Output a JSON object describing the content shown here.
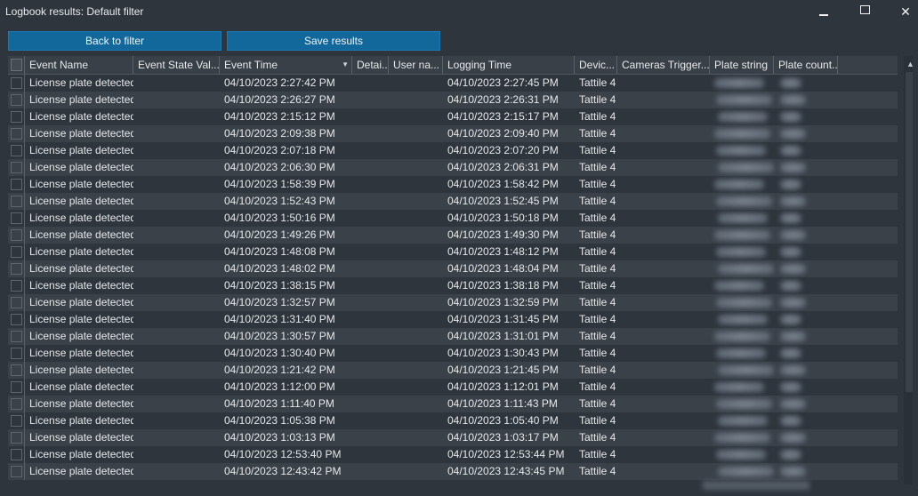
{
  "window": {
    "title": "Logbook results: Default filter",
    "minimize_icon": "minimize-icon",
    "maximize_icon": "maximize-icon",
    "close_icon": "close-icon",
    "close_glyph": "✕"
  },
  "toolbar": {
    "back_label": "Back to filter",
    "save_label": "Save results",
    "button_color": "#13689b"
  },
  "columns": [
    {
      "label": "Event Name"
    },
    {
      "label": "Event State Val..."
    },
    {
      "label": "Event Time",
      "sort_icon": "sort-down-icon",
      "sort_glyph": "▼"
    },
    {
      "label": "Detai..."
    },
    {
      "label": "User na..."
    },
    {
      "label": "Logging Time"
    },
    {
      "label": "Devic..."
    },
    {
      "label": "Cameras Trigger..."
    },
    {
      "label": "Plate string"
    },
    {
      "label": "Plate count..."
    }
  ],
  "rows": [
    {
      "event_name": "License plate detected",
      "event_time": "04/10/2023 2:27:42 PM",
      "logging_time": "04/10/2023 2:27:45 PM",
      "device": "Tattile 4"
    },
    {
      "event_name": "License plate detected",
      "event_time": "04/10/2023 2:26:27 PM",
      "logging_time": "04/10/2023 2:26:31 PM",
      "device": "Tattile 4"
    },
    {
      "event_name": "License plate detected",
      "event_time": "04/10/2023 2:15:12 PM",
      "logging_time": "04/10/2023 2:15:17 PM",
      "device": "Tattile 4"
    },
    {
      "event_name": "License plate detected",
      "event_time": "04/10/2023 2:09:38 PM",
      "logging_time": "04/10/2023 2:09:40 PM",
      "device": "Tattile 4"
    },
    {
      "event_name": "License plate detected",
      "event_time": "04/10/2023 2:07:18 PM",
      "logging_time": "04/10/2023 2:07:20 PM",
      "device": "Tattile 4"
    },
    {
      "event_name": "License plate detected",
      "event_time": "04/10/2023 2:06:30 PM",
      "logging_time": "04/10/2023 2:06:31 PM",
      "device": "Tattile 4"
    },
    {
      "event_name": "License plate detected",
      "event_time": "04/10/2023 1:58:39 PM",
      "logging_time": "04/10/2023 1:58:42 PM",
      "device": "Tattile 4"
    },
    {
      "event_name": "License plate detected",
      "event_time": "04/10/2023 1:52:43 PM",
      "logging_time": "04/10/2023 1:52:45 PM",
      "device": "Tattile 4"
    },
    {
      "event_name": "License plate detected",
      "event_time": "04/10/2023 1:50:16 PM",
      "logging_time": "04/10/2023 1:50:18 PM",
      "device": "Tattile 4"
    },
    {
      "event_name": "License plate detected",
      "event_time": "04/10/2023 1:49:26 PM",
      "logging_time": "04/10/2023 1:49:30 PM",
      "device": "Tattile 4"
    },
    {
      "event_name": "License plate detected",
      "event_time": "04/10/2023 1:48:08 PM",
      "logging_time": "04/10/2023 1:48:12 PM",
      "device": "Tattile 4"
    },
    {
      "event_name": "License plate detected",
      "event_time": "04/10/2023 1:48:02 PM",
      "logging_time": "04/10/2023 1:48:04 PM",
      "device": "Tattile 4"
    },
    {
      "event_name": "License plate detected",
      "event_time": "04/10/2023 1:38:15 PM",
      "logging_time": "04/10/2023 1:38:18 PM",
      "device": "Tattile 4"
    },
    {
      "event_name": "License plate detected",
      "event_time": "04/10/2023 1:32:57 PM",
      "logging_time": "04/10/2023 1:32:59 PM",
      "device": "Tattile 4"
    },
    {
      "event_name": "License plate detected",
      "event_time": "04/10/2023 1:31:40 PM",
      "logging_time": "04/10/2023 1:31:45 PM",
      "device": "Tattile 4"
    },
    {
      "event_name": "License plate detected",
      "event_time": "04/10/2023 1:30:57 PM",
      "logging_time": "04/10/2023 1:31:01 PM",
      "device": "Tattile 4"
    },
    {
      "event_name": "License plate detected",
      "event_time": "04/10/2023 1:30:40 PM",
      "logging_time": "04/10/2023 1:30:43 PM",
      "device": "Tattile 4"
    },
    {
      "event_name": "License plate detected",
      "event_time": "04/10/2023 1:21:42 PM",
      "logging_time": "04/10/2023 1:21:45 PM",
      "device": "Tattile 4"
    },
    {
      "event_name": "License plate detected",
      "event_time": "04/10/2023 1:12:00 PM",
      "logging_time": "04/10/2023 1:12:01 PM",
      "device": "Tattile 4"
    },
    {
      "event_name": "License plate detected",
      "event_time": "04/10/2023 1:11:40 PM",
      "logging_time": "04/10/2023 1:11:43 PM",
      "device": "Tattile 4"
    },
    {
      "event_name": "License plate detected",
      "event_time": "04/10/2023 1:05:38 PM",
      "logging_time": "04/10/2023 1:05:40 PM",
      "device": "Tattile 4"
    },
    {
      "event_name": "License plate detected",
      "event_time": "04/10/2023 1:03:13 PM",
      "logging_time": "04/10/2023 1:03:17 PM",
      "device": "Tattile 4"
    },
    {
      "event_name": "License plate detected",
      "event_time": "04/10/2023 12:53:40 PM",
      "logging_time": "04/10/2023 12:53:44 PM",
      "device": "Tattile 4"
    },
    {
      "event_name": "License plate detected",
      "event_time": "04/10/2023 12:43:42 PM",
      "logging_time": "04/10/2023 12:43:45 PM",
      "device": "Tattile 4"
    }
  ],
  "scrollbar": {
    "up_icon": "scroll-up-icon",
    "up_glyph": "▲"
  }
}
